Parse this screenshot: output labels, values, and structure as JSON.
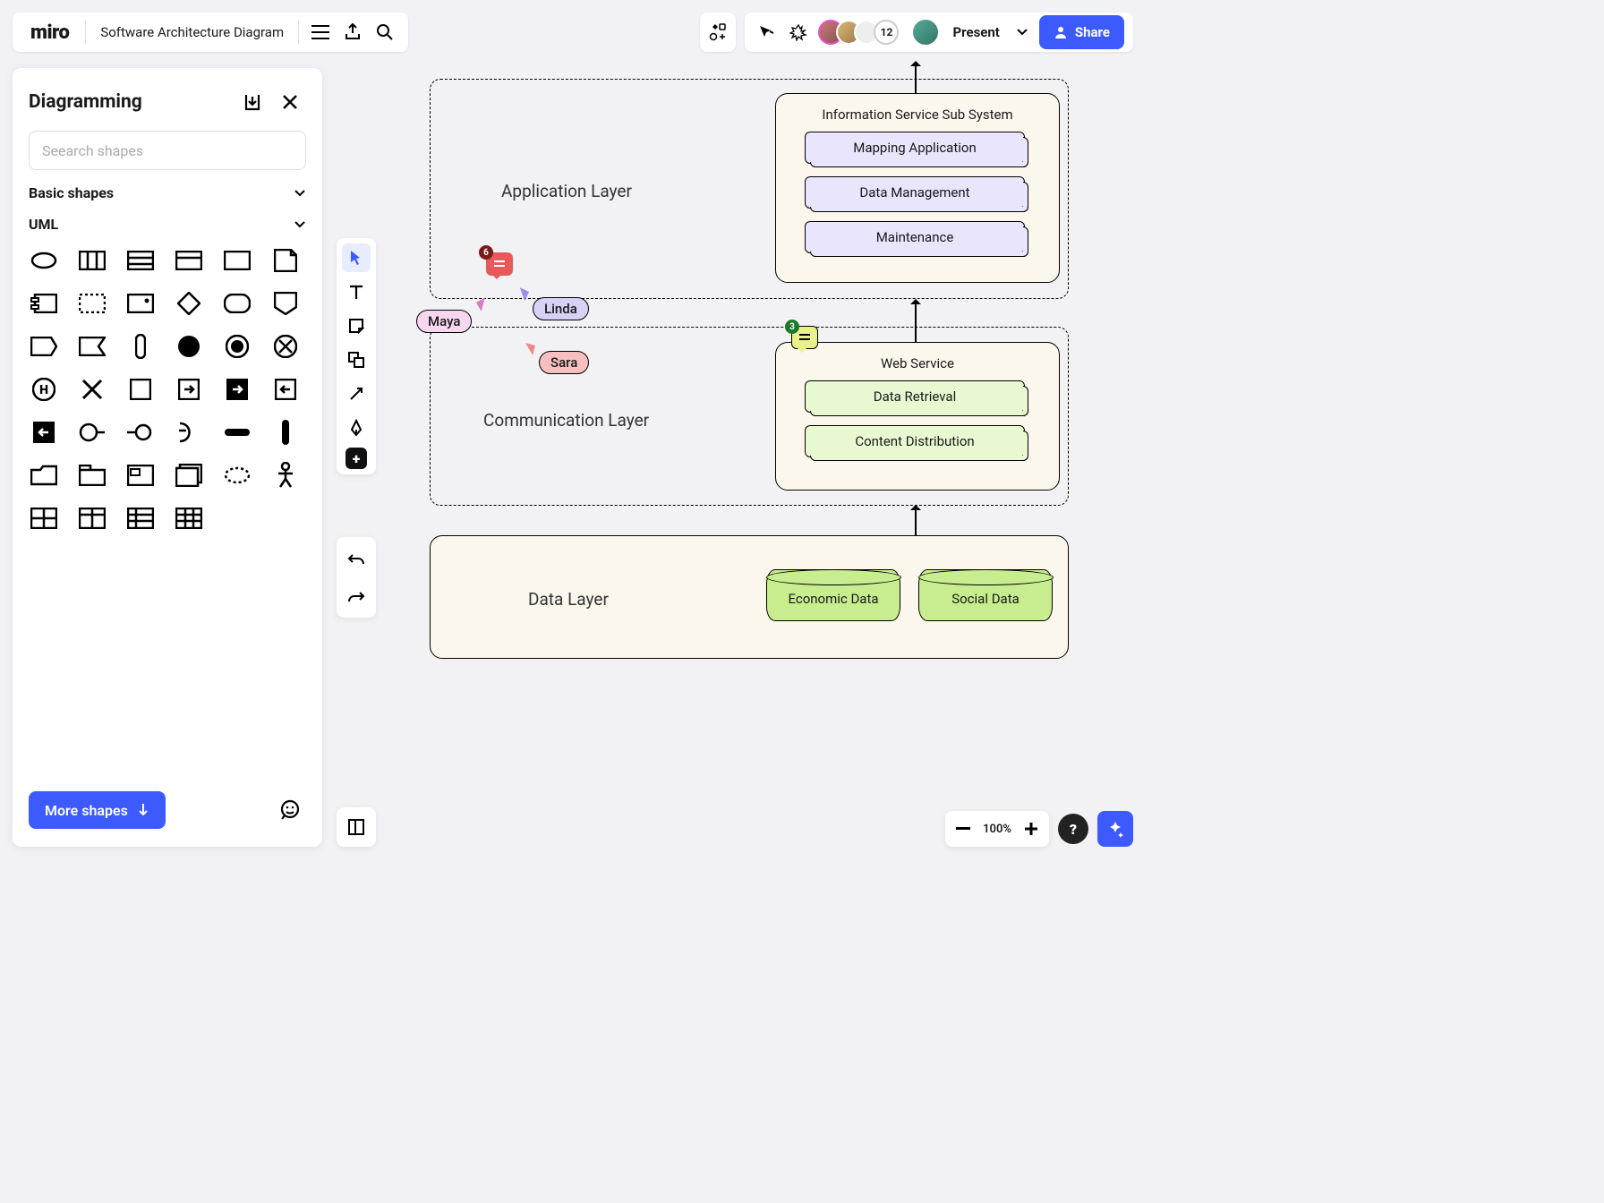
{
  "header": {
    "logo": "miro",
    "board_title": "Software Architecture Diagram",
    "present": "Present",
    "share": "Share",
    "user_count": "12"
  },
  "panel": {
    "title": "Diagramming",
    "search_placeholder": "Seearch shapes",
    "sections": {
      "basic": "Basic shapes",
      "uml": "UML"
    },
    "more_shapes": "More shapes"
  },
  "zoom": {
    "level": "100%"
  },
  "help": "?",
  "diagram": {
    "app_layer": "Application Layer",
    "comm_layer": "Communication Layer",
    "data_layer": "Data Layer",
    "info_box": {
      "title": "Information Service Sub System",
      "items": [
        "Mapping Application",
        "Data Management",
        "Maintenance"
      ]
    },
    "web_box": {
      "title": "Web Service",
      "items": [
        "Data Retrieval",
        "Content Distribution"
      ]
    },
    "cylinders": [
      "Economic Data",
      "Social Data"
    ]
  },
  "cursors": {
    "maya": "Maya",
    "linda": "Linda",
    "sara": "Sara"
  },
  "chat": {
    "red_count": "6",
    "green_count": "3"
  }
}
